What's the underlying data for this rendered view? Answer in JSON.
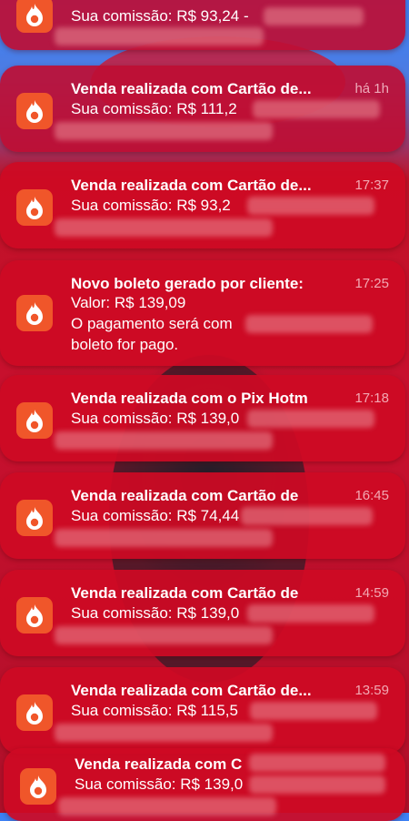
{
  "notifications": [
    {
      "title": "",
      "time": "",
      "body_lines": [
        "Sua comissão: R$ 93,24 -"
      ]
    },
    {
      "title": "Venda realizada com Cartão de...",
      "time": "há 1h",
      "body_lines": [
        "Sua comissão: R$ 111,2"
      ]
    },
    {
      "title": "Venda realizada com Cartão de...",
      "time": "17:37",
      "body_lines": [
        "Sua comissão: R$ 93,2"
      ]
    },
    {
      "title": "Novo boleto gerado por cliente:",
      "time": "17:25",
      "body_lines": [
        "Valor: R$ 139,09",
        "O pagamento será com",
        "boleto for pago."
      ]
    },
    {
      "title": "Venda realizada com o Pix Hotm",
      "time": "17:18",
      "body_lines": [
        "Sua comissão: R$ 139,0"
      ]
    },
    {
      "title": "Venda realizada com Cartão de",
      "time": "16:45",
      "body_lines": [
        "Sua comissão: R$ 74,44"
      ]
    },
    {
      "title": "Venda realizada com Cartão de",
      "time": "14:59",
      "body_lines": [
        "Sua comissão: R$ 139,0"
      ]
    },
    {
      "title": "Venda realizada com Cartão de...",
      "time": "13:59",
      "body_lines": [
        "Sua comissão: R$ 115,5"
      ]
    },
    {
      "title": "Venda realizada com C",
      "time": "",
      "body_lines": [
        "Sua comissão: R$ 139,0"
      ]
    }
  ],
  "icon": "hotmart-flame-icon",
  "colors": {
    "notification_bg": "#ce0a24",
    "app_icon_bg": "#f0562a",
    "text": "#ffffff"
  }
}
